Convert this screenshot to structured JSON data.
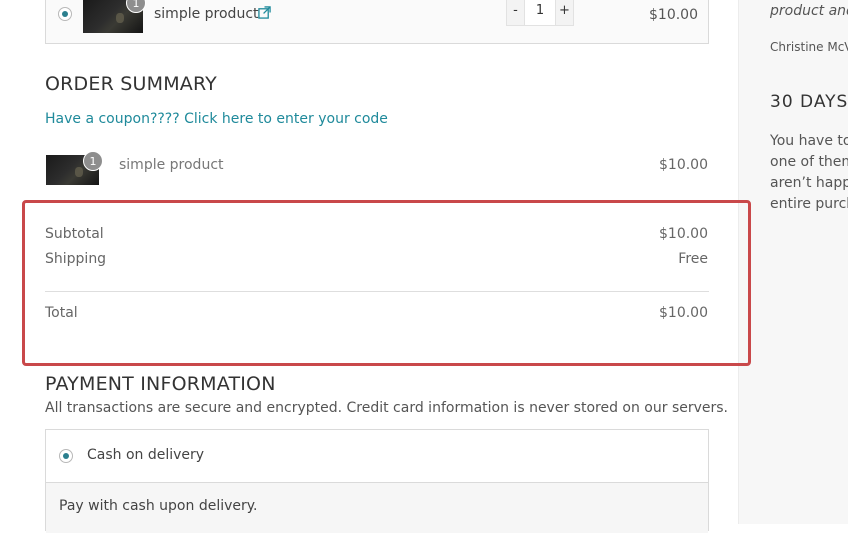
{
  "cart_item": {
    "name": "simple product",
    "quantity": "1",
    "minus_label": "-",
    "plus_label": "+",
    "price": "$10.00",
    "badge": "1",
    "selected": true
  },
  "order_summary": {
    "title": "ORDER SUMMARY",
    "coupon_link": "Have a coupon???? Click here to enter your code",
    "item": {
      "name": "simple product",
      "badge": "1",
      "price": "$10.00"
    },
    "subtotal_label": "Subtotal",
    "subtotal_value": "$10.00",
    "shipping_label": "Shipping",
    "shipping_value": "Free",
    "total_label": "Total",
    "total_value": "$10.00"
  },
  "payment": {
    "title": "PAYMENT INFORMATION",
    "secure_note": "All transactions are secure and encrypted. Credit card information is never stored on our servers.",
    "method_label": "Cash on delivery",
    "method_description": "Pay with cash upon delivery."
  },
  "sidebar": {
    "quote_fragment": "product and",
    "author_fragment": "Christine McV",
    "guarantee_title_fragment": "30 DAYS",
    "text_lines": [
      "You have to",
      "one of them",
      "aren’t happy",
      "entire purch"
    ]
  },
  "colors": {
    "accent": "#1f8a9b",
    "highlight_border": "#c9484a"
  }
}
